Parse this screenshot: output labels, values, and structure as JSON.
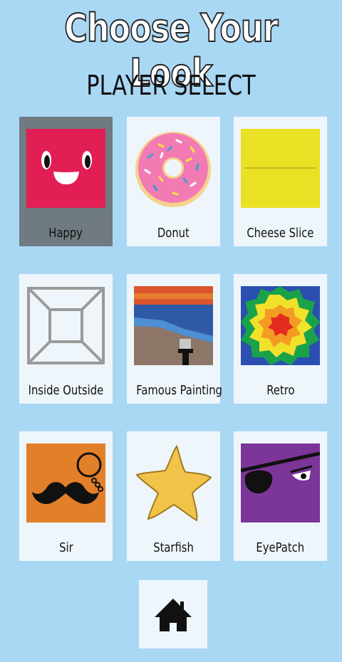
{
  "header": {
    "title": "Choose Your Look",
    "subtitle": "PLAYER SELECT"
  },
  "characters": [
    {
      "label": "Happy",
      "icon": "happy-face-icon",
      "selected": true,
      "color": "#e21f55"
    },
    {
      "label": "Donut",
      "icon": "donut-icon",
      "selected": false,
      "color": "#f27bb3"
    },
    {
      "label": "Cheese Slice",
      "icon": "cheese-slice-icon",
      "selected": false,
      "color": "#ebe124"
    },
    {
      "label": "Inside Outside",
      "icon": "inside-outside-icon",
      "selected": false,
      "color": "#9a9a9a"
    },
    {
      "label": "Famous Painting",
      "icon": "famous-painting-icon",
      "selected": false,
      "color": "#d9552e"
    },
    {
      "label": "Retro",
      "icon": "retro-tie-dye-icon",
      "selected": false,
      "color": "#1aa24a"
    },
    {
      "label": "Sir",
      "icon": "sir-mustache-icon",
      "selected": false,
      "color": "#e27f29"
    },
    {
      "label": "Starfish",
      "icon": "starfish-icon",
      "selected": false,
      "color": "#f1c34a"
    },
    {
      "label": "EyePatch",
      "icon": "eyepatch-icon",
      "selected": false,
      "color": "#7c3598"
    }
  ],
  "home_button": {
    "icon": "home-icon"
  }
}
